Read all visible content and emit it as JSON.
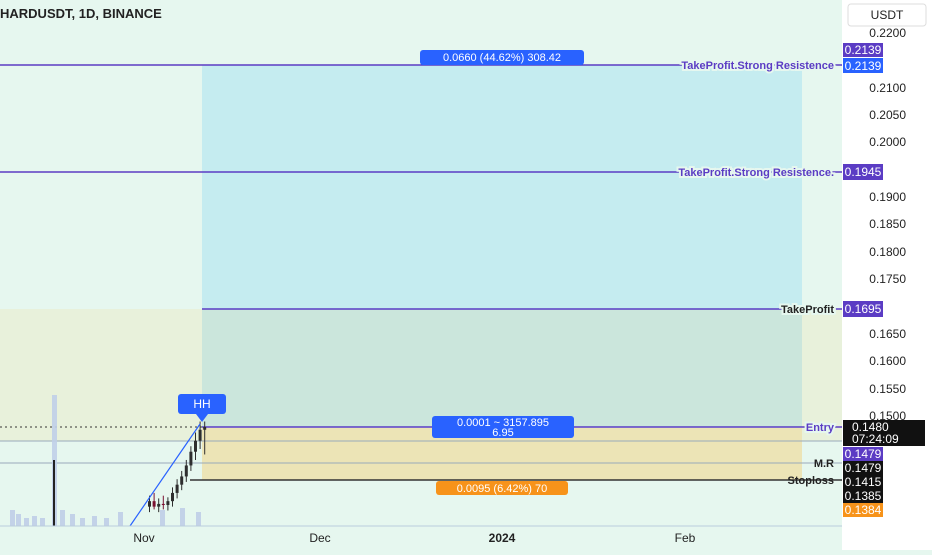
{
  "header": {
    "title": "HARDUSDT, 1D, BINANCE"
  },
  "axis": {
    "currency": "USDT",
    "ticks": [
      "0.2200",
      "0.2100",
      "0.2050",
      "0.2000",
      "0.1950",
      "0.1900",
      "0.1850",
      "0.1800",
      "0.1750",
      "0.1700",
      "0.1650",
      "0.1600",
      "0.1550",
      "0.1500",
      "0.1450"
    ],
    "months": [
      "Nov",
      "Dec",
      "2024",
      "Feb"
    ]
  },
  "levels": [
    {
      "name": "tp-strong-1",
      "label": "TakeProfit.Strong Resistence",
      "value": "0.2139",
      "color": "#5b3cc4"
    },
    {
      "name": "tp-strong-2",
      "label": "TakeProfit.Strong Resistence.",
      "value": "0.1945",
      "color": "#5b3cc4"
    },
    {
      "name": "tp",
      "label": "TakeProfit",
      "value": "0.1695",
      "color": "#5b3cc4"
    },
    {
      "name": "entry",
      "label": "Entry",
      "value": "0.1480",
      "color": "#5b3cc4"
    },
    {
      "name": "mr",
      "label": "M.R",
      "value": "0.1479",
      "color": "#333333"
    },
    {
      "name": "stoploss",
      "label": "Stoploss",
      "value": "0.1415",
      "color": "#333333"
    }
  ],
  "price_tags": {
    "top_extra": "0.2139",
    "entry_countdown": "07:24:09",
    "purple_low": "0.1479",
    "low_1": "0.1385",
    "orange_low": "0.1384"
  },
  "annotations": {
    "target_label": "0.0660 (44.62%) 308.42",
    "entry_label_line1": "0.0001 ~ 3157.895",
    "entry_label_line2": "6.95",
    "stop_label": "0.0095 (6.42%) 70",
    "hh_label": "HH"
  },
  "chart_data": {
    "type": "candlestick",
    "title": "HARDUSDT, 1D, BINANCE",
    "ylim": [
      0.132,
      0.223
    ],
    "candles": [
      {
        "o": 0.1335,
        "h": 0.1355,
        "l": 0.1325,
        "c": 0.1345
      },
      {
        "o": 0.1345,
        "h": 0.136,
        "l": 0.133,
        "c": 0.1335
      },
      {
        "o": 0.1335,
        "h": 0.135,
        "l": 0.1325,
        "c": 0.134
      },
      {
        "o": 0.134,
        "h": 0.1355,
        "l": 0.133,
        "c": 0.1338
      },
      {
        "o": 0.1338,
        "h": 0.1352,
        "l": 0.1328,
        "c": 0.1345
      },
      {
        "o": 0.1345,
        "h": 0.137,
        "l": 0.1335,
        "c": 0.136
      },
      {
        "o": 0.136,
        "h": 0.1385,
        "l": 0.135,
        "c": 0.1375
      },
      {
        "o": 0.1375,
        "h": 0.14,
        "l": 0.1365,
        "c": 0.139
      },
      {
        "o": 0.139,
        "h": 0.142,
        "l": 0.138,
        "c": 0.141
      },
      {
        "o": 0.141,
        "h": 0.1445,
        "l": 0.14,
        "c": 0.1435
      },
      {
        "o": 0.1435,
        "h": 0.147,
        "l": 0.142,
        "c": 0.1455
      },
      {
        "o": 0.1455,
        "h": 0.149,
        "l": 0.144,
        "c": 0.1475
      },
      {
        "o": 0.1475,
        "h": 0.149,
        "l": 0.143,
        "c": 0.148
      }
    ]
  }
}
